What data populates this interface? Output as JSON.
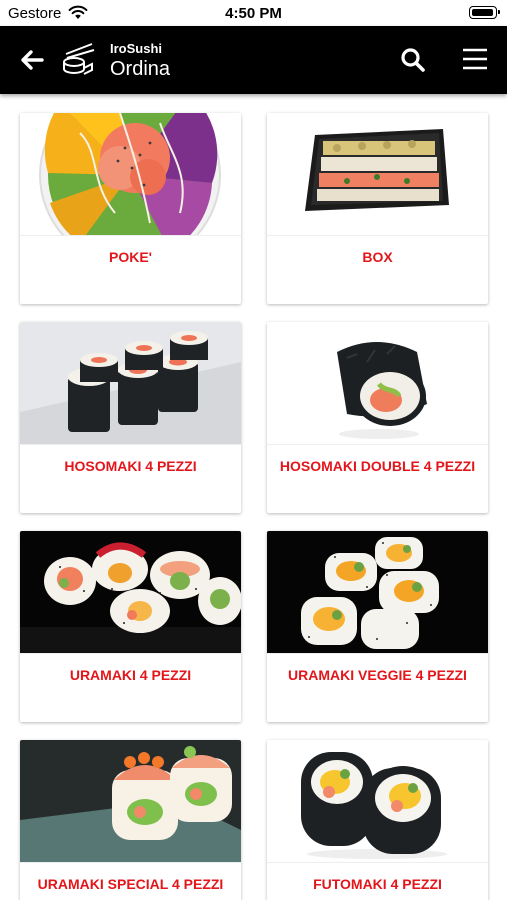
{
  "status_bar": {
    "carrier": "Gestore",
    "time": "4:50 PM"
  },
  "header": {
    "app_name": "IroSushi",
    "title": "Ordina",
    "icons": [
      "back-arrow-icon",
      "sushi-logo-icon",
      "search-icon",
      "hamburger-menu-icon"
    ],
    "background": "#000000"
  },
  "accent_color": "#e3161b",
  "categories": [
    {
      "label": "POKE'",
      "image": "poke-bowl"
    },
    {
      "label": "BOX",
      "image": "sushi-box"
    },
    {
      "label": "HOSOMAKI 4 PEZZI",
      "image": "hosomaki"
    },
    {
      "label": "HOSOMAKI DOUBLE 4 PEZZI",
      "image": "hosomaki-double"
    },
    {
      "label": "URAMAKI 4 PEZZI",
      "image": "uramaki"
    },
    {
      "label": "URAMAKI VEGGIE 4 PEZZI",
      "image": "uramaki-veggie"
    },
    {
      "label": "URAMAKI SPECIAL 4 PEZZI",
      "image": "uramaki-special"
    },
    {
      "label": "FUTOMAKI 4 PEZZI",
      "image": "futomaki"
    }
  ]
}
